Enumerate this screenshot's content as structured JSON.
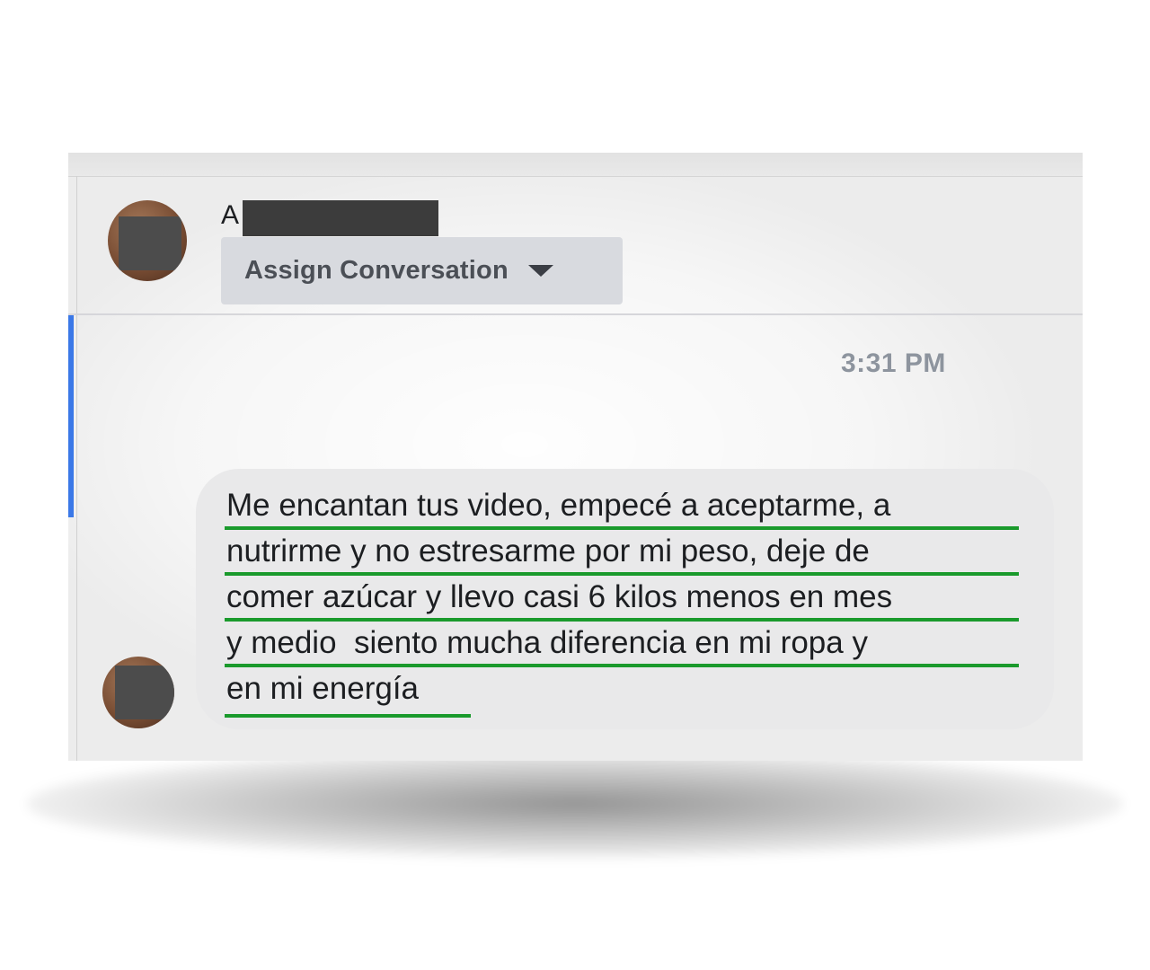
{
  "conversation": {
    "contact_initial": "A",
    "assign_button_label": "Assign Conversation",
    "timestamp": "3:31 PM",
    "message_lines": [
      "Me encantan tus video, empecé a aceptarme, a",
      "nutrirme y no estresarme por mi peso, deje de",
      "comer azúcar y llevo casi 6 kilos menos en mes",
      "y medio  siento mucha diferencia en mi ropa y",
      "en mi energía"
    ]
  },
  "colors": {
    "unread_indicator": "#3b78e7",
    "highlight_underline": "#1a9a2c",
    "bubble": "#e9e9ea",
    "assign_button": "#d8dadf"
  }
}
